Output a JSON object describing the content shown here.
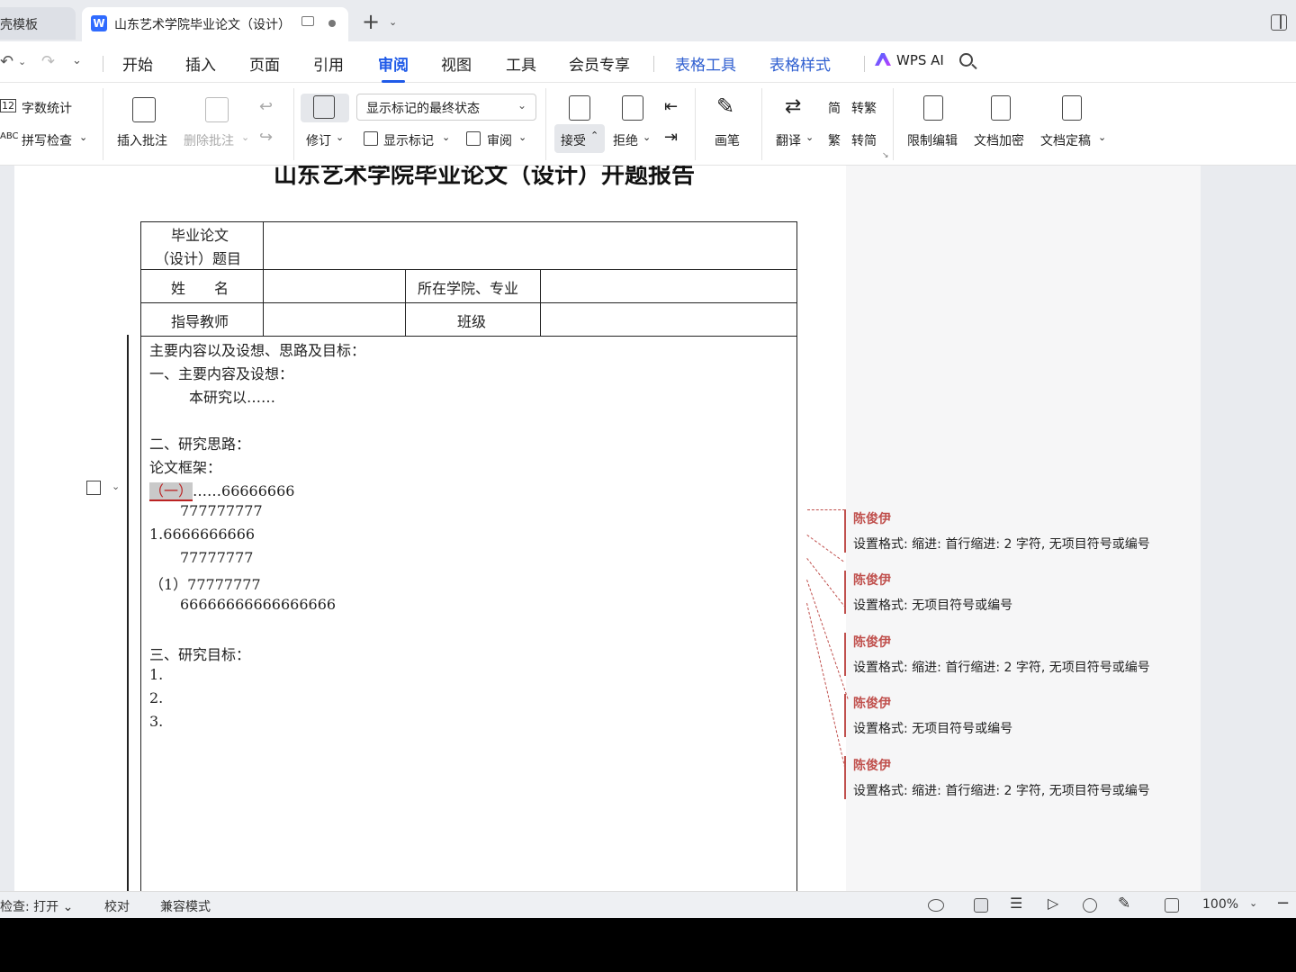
{
  "titlebar": {
    "prev_tab": "壳模板",
    "active_tab": "山东艺术学院毕业论文（设计）",
    "app_logo": "W"
  },
  "menu": {
    "items": [
      "开始",
      "插入",
      "页面",
      "引用",
      "审阅",
      "视图",
      "工具",
      "会员专享"
    ],
    "active": "审阅",
    "context_items": [
      "表格工具",
      "表格样式"
    ],
    "ai_label": "WPS AI",
    "accent_color": "#1f5ae8"
  },
  "ribbon": {
    "word_count": "字数统计",
    "spell_check": "拼写检查",
    "insert_comment": "插入批注",
    "delete_comment": "删除批注",
    "markup_dropdown": "显示标记的最终状态",
    "track_changes": "修订",
    "show_markup": "显示标记",
    "review": "审阅",
    "accept": "接受",
    "reject": "拒绝",
    "pen": "画笔",
    "translate": "翻译",
    "to_traditional": "转繁",
    "to_simplified": "转简",
    "restrict_edit": "限制编辑",
    "encrypt": "文档加密",
    "finalize": "文档定稿"
  },
  "document": {
    "title": "山东艺术学院毕业论文（设计）开题报告",
    "table": {
      "topic_label_1": "毕业论文",
      "topic_label_2": "（设计）题目",
      "name_label": "姓　　名",
      "college_label": "所在学院、专业",
      "advisor_label": "指导教师",
      "class_label": "班级"
    },
    "body": [
      "主要内容以及设想、思路及目标：",
      "一、主要内容及设想：",
      "本研究以……",
      "二、研究思路：",
      "论文框架：",
      "……66666666",
      "777777777",
      "1.6666666666",
      "77777777",
      "（1）77777777",
      "66666666666666666",
      "三、研究目标：",
      "1.",
      "2.",
      "3."
    ],
    "highlight": "（一）"
  },
  "comments": [
    {
      "author": "陈俊伊",
      "text": "设置格式: 缩进: 首行缩进: 2 字符, 无项目符号或编号"
    },
    {
      "author": "陈俊伊",
      "text": "设置格式: 无项目符号或编号"
    },
    {
      "author": "陈俊伊",
      "text": "设置格式: 缩进: 首行缩进: 2 字符, 无项目符号或编号"
    },
    {
      "author": "陈俊伊",
      "text": "设置格式: 无项目符号或编号"
    },
    {
      "author": "陈俊伊",
      "text": "设置格式: 缩进: 首行缩进: 2 字符, 无项目符号或编号"
    }
  ],
  "statusbar": {
    "check": "检查: 打开",
    "proof": "校对",
    "compat": "兼容模式",
    "zoom": "100%"
  }
}
